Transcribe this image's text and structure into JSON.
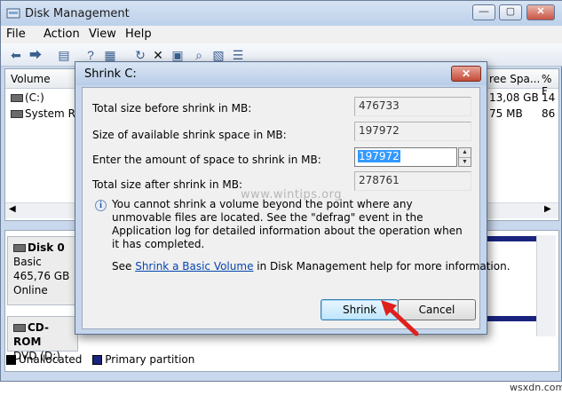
{
  "window": {
    "title": "Disk Management"
  },
  "menu": [
    "File",
    "Action",
    "View",
    "Help"
  ],
  "volume_list": {
    "columns": [
      "Volume",
      "ree Spa...",
      "% F"
    ],
    "rows": [
      {
        "volume": "(C:)",
        "free": "13,08 GB",
        "pct": "14"
      },
      {
        "volume": "System Res",
        "free": "75 MB",
        "pct": "86"
      }
    ]
  },
  "disks": [
    {
      "name": "Disk 0",
      "type": "Basic",
      "size": "465,76 GB",
      "status": "Online"
    },
    {
      "name": "CD-ROM",
      "type": "DVD (D:)"
    }
  ],
  "legend": [
    {
      "label": "Unallocated",
      "color": "#000000"
    },
    {
      "label": "Primary partition",
      "color": "#1a237e"
    }
  ],
  "dialog": {
    "title": "Shrink C:",
    "fields": {
      "total_before_label": "Total size before shrink in MB:",
      "total_before_value": "476733",
      "available_label": "Size of available shrink space in MB:",
      "available_value": "197972",
      "amount_label": "Enter the amount of space to shrink in MB:",
      "amount_value": "197972",
      "after_label": "Total size after shrink in MB:",
      "after_value": "278761"
    },
    "info": "You cannot shrink a volume beyond the point where any unmovable files are located. See the \"defrag\" event in the Application log for detailed information about the operation when it has completed.",
    "help_prefix": "See ",
    "help_link": "Shrink a Basic Volume",
    "help_suffix": " in Disk Management help for more information.",
    "shrink_label": "Shrink",
    "cancel_label": "Cancel"
  },
  "watermark": "www.wintips.org",
  "site_mark": "wsxdn.com"
}
